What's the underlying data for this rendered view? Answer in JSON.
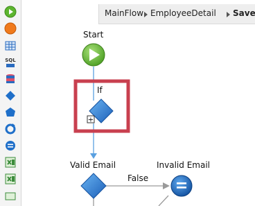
{
  "breadcrumb": {
    "items": [
      "MainFlow",
      "EmployeeDetail",
      "Save"
    ]
  },
  "toolbox": {
    "tools": [
      {
        "icon": "start-icon"
      },
      {
        "icon": "end-icon"
      },
      {
        "icon": "aggregate-icon"
      },
      {
        "icon": "sql-icon",
        "text": "SQL"
      },
      {
        "icon": "entity-action-icon"
      },
      {
        "icon": "if-icon"
      },
      {
        "icon": "switch-icon"
      },
      {
        "icon": "foreach-icon"
      },
      {
        "icon": "assign-icon"
      },
      {
        "icon": "excel-to-record-list-icon"
      },
      {
        "icon": "record-list-to-excel-icon"
      }
    ]
  },
  "flow": {
    "start_label": "Start",
    "if_label": "If",
    "valid_email_label": "Valid Email",
    "invalid_email_label": "Invalid Email",
    "false_label": "False",
    "expand_symbol": "+"
  },
  "colors": {
    "highlight": "#c8404f",
    "flow_line": "#5aa0e0",
    "diamond": "#1f6fc9",
    "start_green": "#5db52f"
  }
}
